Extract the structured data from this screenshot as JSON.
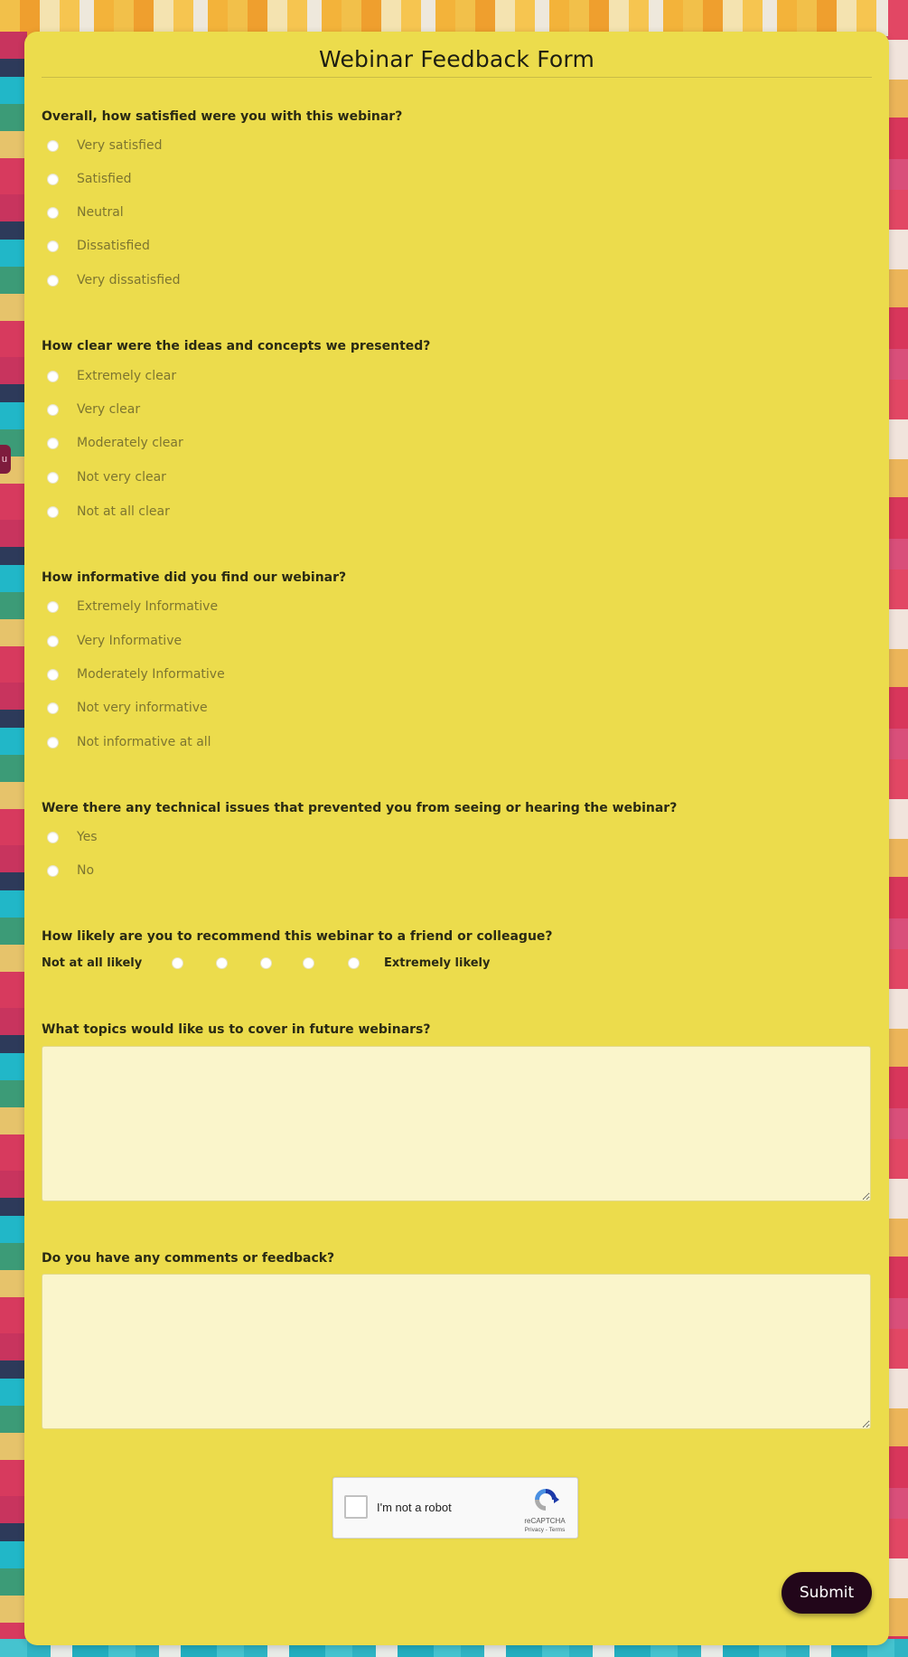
{
  "form": {
    "title": "Webinar Feedback Form",
    "side_tab_text": "u",
    "questions": [
      {
        "label": "Overall, how satisfied were you with this webinar?",
        "options": [
          "Very satisfied",
          "Satisfied",
          "Neutral",
          "Dissatisfied",
          "Very dissatisfied"
        ]
      },
      {
        "label": "How clear were the ideas and concepts we presented?",
        "options": [
          "Extremely clear",
          "Very clear",
          "Moderately clear",
          "Not very clear",
          "Not at all clear"
        ]
      },
      {
        "label": "How informative did you find our webinar?",
        "options": [
          "Extremely Informative",
          "Very Informative",
          "Moderately Informative",
          "Not very informative",
          "Not informative at all"
        ]
      },
      {
        "label": "Were there any technical issues that prevented you from seeing or hearing the webinar?",
        "options": [
          "Yes",
          "No"
        ]
      }
    ],
    "recommend": {
      "label": "How likely are you to recommend this webinar to a friend or colleague?",
      "low_label": "Not at all likely",
      "high_label": "Extremely likely",
      "points": 5
    },
    "topics": {
      "label": "What topics would like us to cover in future webinars?",
      "value": ""
    },
    "comments": {
      "label": "Do you have any comments or feedback?",
      "value": ""
    },
    "captcha": {
      "label": "I'm not a robot",
      "brand": "reCAPTCHA",
      "links": "Privacy - Terms"
    },
    "submit_label": "Submit"
  }
}
